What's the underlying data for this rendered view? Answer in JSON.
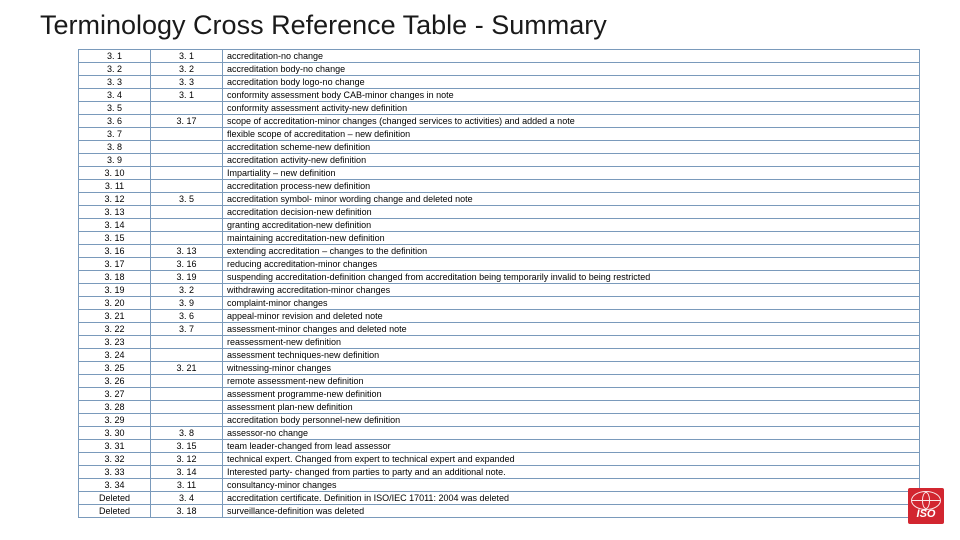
{
  "title": "Terminology Cross Reference Table - Summary",
  "logo": {
    "text": "ISO",
    "name": "iso-logo"
  },
  "chart_data": {
    "type": "table",
    "title": "Terminology Cross Reference Table - Summary",
    "columns": [
      "col_a",
      "col_b",
      "description"
    ],
    "rows": [
      {
        "col_a": "3. 1",
        "col_b": "3. 1",
        "description": "accreditation-no change"
      },
      {
        "col_a": "3. 2",
        "col_b": "3. 2",
        "description": "accreditation body-no change"
      },
      {
        "col_a": "3. 3",
        "col_b": "3. 3",
        "description": "accreditation body logo-no change"
      },
      {
        "col_a": "3. 4",
        "col_b": "3. 1",
        "description": "conformity assessment body CAB-minor changes in note"
      },
      {
        "col_a": "3. 5",
        "col_b": "",
        "description": "conformity assessment activity-new definition"
      },
      {
        "col_a": "3. 6",
        "col_b": "3. 17",
        "description": "scope of accreditation-minor changes (changed services to activities) and added a note"
      },
      {
        "col_a": "3. 7",
        "col_b": "",
        "description": "flexible scope of accreditation – new definition"
      },
      {
        "col_a": "3. 8",
        "col_b": "",
        "description": "accreditation scheme-new definition"
      },
      {
        "col_a": "3. 9",
        "col_b": "",
        "description": "accreditation activity-new definition"
      },
      {
        "col_a": "3. 10",
        "col_b": "",
        "description": "Impartiality – new definition"
      },
      {
        "col_a": "3. 11",
        "col_b": "",
        "description": "accreditation process-new definition"
      },
      {
        "col_a": "3. 12",
        "col_b": "3. 5",
        "description": "accreditation symbol- minor wording change and deleted note"
      },
      {
        "col_a": "3. 13",
        "col_b": "",
        "description": "accreditation decision-new definition"
      },
      {
        "col_a": "3. 14",
        "col_b": "",
        "description": "granting accreditation-new definition"
      },
      {
        "col_a": "3. 15",
        "col_b": "",
        "description": "maintaining accreditation-new definition"
      },
      {
        "col_a": "3. 16",
        "col_b": "3. 13",
        "description": "extending accreditation – changes to the definition"
      },
      {
        "col_a": "3. 17",
        "col_b": "3. 16",
        "description": "reducing accreditation-minor changes"
      },
      {
        "col_a": "3. 18",
        "col_b": "3. 19",
        "description": "suspending accreditation-definition changed from accreditation being temporarily invalid to being restricted"
      },
      {
        "col_a": "3. 19",
        "col_b": "3. 2",
        "description": "withdrawing accreditation-minor changes"
      },
      {
        "col_a": "3. 20",
        "col_b": "3. 9",
        "description": "complaint-minor changes"
      },
      {
        "col_a": "3. 21",
        "col_b": "3. 6",
        "description": "appeal-minor revision and deleted note"
      },
      {
        "col_a": "3. 22",
        "col_b": "3. 7",
        "description": "assessment-minor changes and deleted note"
      },
      {
        "col_a": "3. 23",
        "col_b": "",
        "description": "reassessment-new definition"
      },
      {
        "col_a": "3. 24",
        "col_b": "",
        "description": "assessment techniques-new definition"
      },
      {
        "col_a": "3. 25",
        "col_b": "3. 21",
        "description": "witnessing-minor changes"
      },
      {
        "col_a": "3. 26",
        "col_b": "",
        "description": "remote assessment-new definition"
      },
      {
        "col_a": "3. 27",
        "col_b": "",
        "description": "assessment programme-new definition"
      },
      {
        "col_a": "3. 28",
        "col_b": "",
        "description": "assessment plan-new definition"
      },
      {
        "col_a": "3. 29",
        "col_b": "",
        "description": "accreditation body personnel-new definition"
      },
      {
        "col_a": "3. 30",
        "col_b": "3. 8",
        "description": "assessor-no change"
      },
      {
        "col_a": "3. 31",
        "col_b": "3. 15",
        "description": "team leader-changed from lead assessor"
      },
      {
        "col_a": "3. 32",
        "col_b": "3. 12",
        "description": "technical expert.  Changed from expert to technical expert and expanded"
      },
      {
        "col_a": "3. 33",
        "col_b": "3. 14",
        "description": "Interested party- changed from parties to party and an additional note."
      },
      {
        "col_a": "3. 34",
        "col_b": "3. 11",
        "description": "consultancy-minor changes"
      },
      {
        "col_a": "Deleted",
        "col_b": "3. 4",
        "description": "accreditation certificate.  Definition in ISO/IEC 17011: 2004 was deleted"
      },
      {
        "col_a": "Deleted",
        "col_b": "3. 18",
        "description": "surveillance-definition was deleted"
      }
    ]
  }
}
